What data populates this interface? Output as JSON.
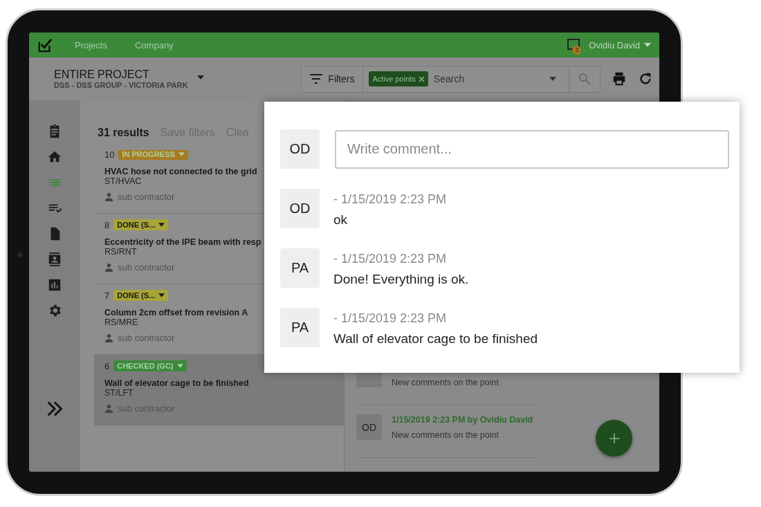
{
  "header": {
    "nav": [
      {
        "label": "Projects"
      },
      {
        "label": "Company"
      }
    ],
    "notifications": "3",
    "user": "Ovidiu David"
  },
  "toolbar": {
    "project": "ENTIRE PROJECT",
    "subtitle": "DSS - DSS GROUP - VICTORIA PARK",
    "filters": "Filters",
    "chip": "Active points",
    "search": {
      "placeholder": "Search"
    }
  },
  "sidebar": {
    "items": [
      {
        "kind": "clipboard",
        "selected": false
      },
      {
        "kind": "home",
        "selected": false
      },
      {
        "kind": "list",
        "selected": true
      },
      {
        "kind": "checklist",
        "selected": false
      },
      {
        "kind": "document",
        "selected": false
      },
      {
        "kind": "contacts",
        "selected": false
      },
      {
        "kind": "chart",
        "selected": false
      },
      {
        "kind": "settings",
        "selected": false
      }
    ]
  },
  "results": {
    "count": "31 results",
    "save": "Save filters",
    "clear": "Clea"
  },
  "points": [
    {
      "number": "10",
      "status": "IN PROGRESS",
      "color": "#a87a1e",
      "title": "HVAC hose not connected to the grid",
      "code": "ST/HVAC",
      "assignee": "sub contractor",
      "selected": false
    },
    {
      "number": "8",
      "status": "DONE (S...",
      "color": "#a8a437",
      "title": "Eccentricity of the IPE beam with resp",
      "code": "RS/RNT",
      "assignee": "sub contractor",
      "selected": false
    },
    {
      "number": "7",
      "status": "DONE (S...",
      "color": "#a8a437",
      "title": "Column 2cm offset from revision A",
      "code": "RS/MRE",
      "assignee": "sub contractor",
      "selected": false
    },
    {
      "number": "6",
      "status": "CHECKED (GC)",
      "color": "#3b8a3b",
      "title": "Wall of elevator cage to be finished",
      "code": "ST/LFT",
      "assignee": "sub contractor",
      "selected": true
    }
  ],
  "history": [
    {
      "text": "New comments on the point"
    },
    {
      "avatar": "OD",
      "date": "1/15/2019 2:23 PM by Ovidiu David",
      "text": "New comments on the point"
    }
  ],
  "comments": {
    "avatar": "OD",
    "placeholder": "Write comment...",
    "items": [
      {
        "avatar": "OD",
        "time": "- 1/15/2019 2:23 PM",
        "text": "ok"
      },
      {
        "avatar": "PA",
        "time": "- 1/15/2019 2:23 PM",
        "text": "Done! Everything is ok."
      },
      {
        "avatar": "PA",
        "time": "- 1/15/2019 2:23 PM",
        "text": "Wall of elevator cage to be finished"
      }
    ]
  }
}
